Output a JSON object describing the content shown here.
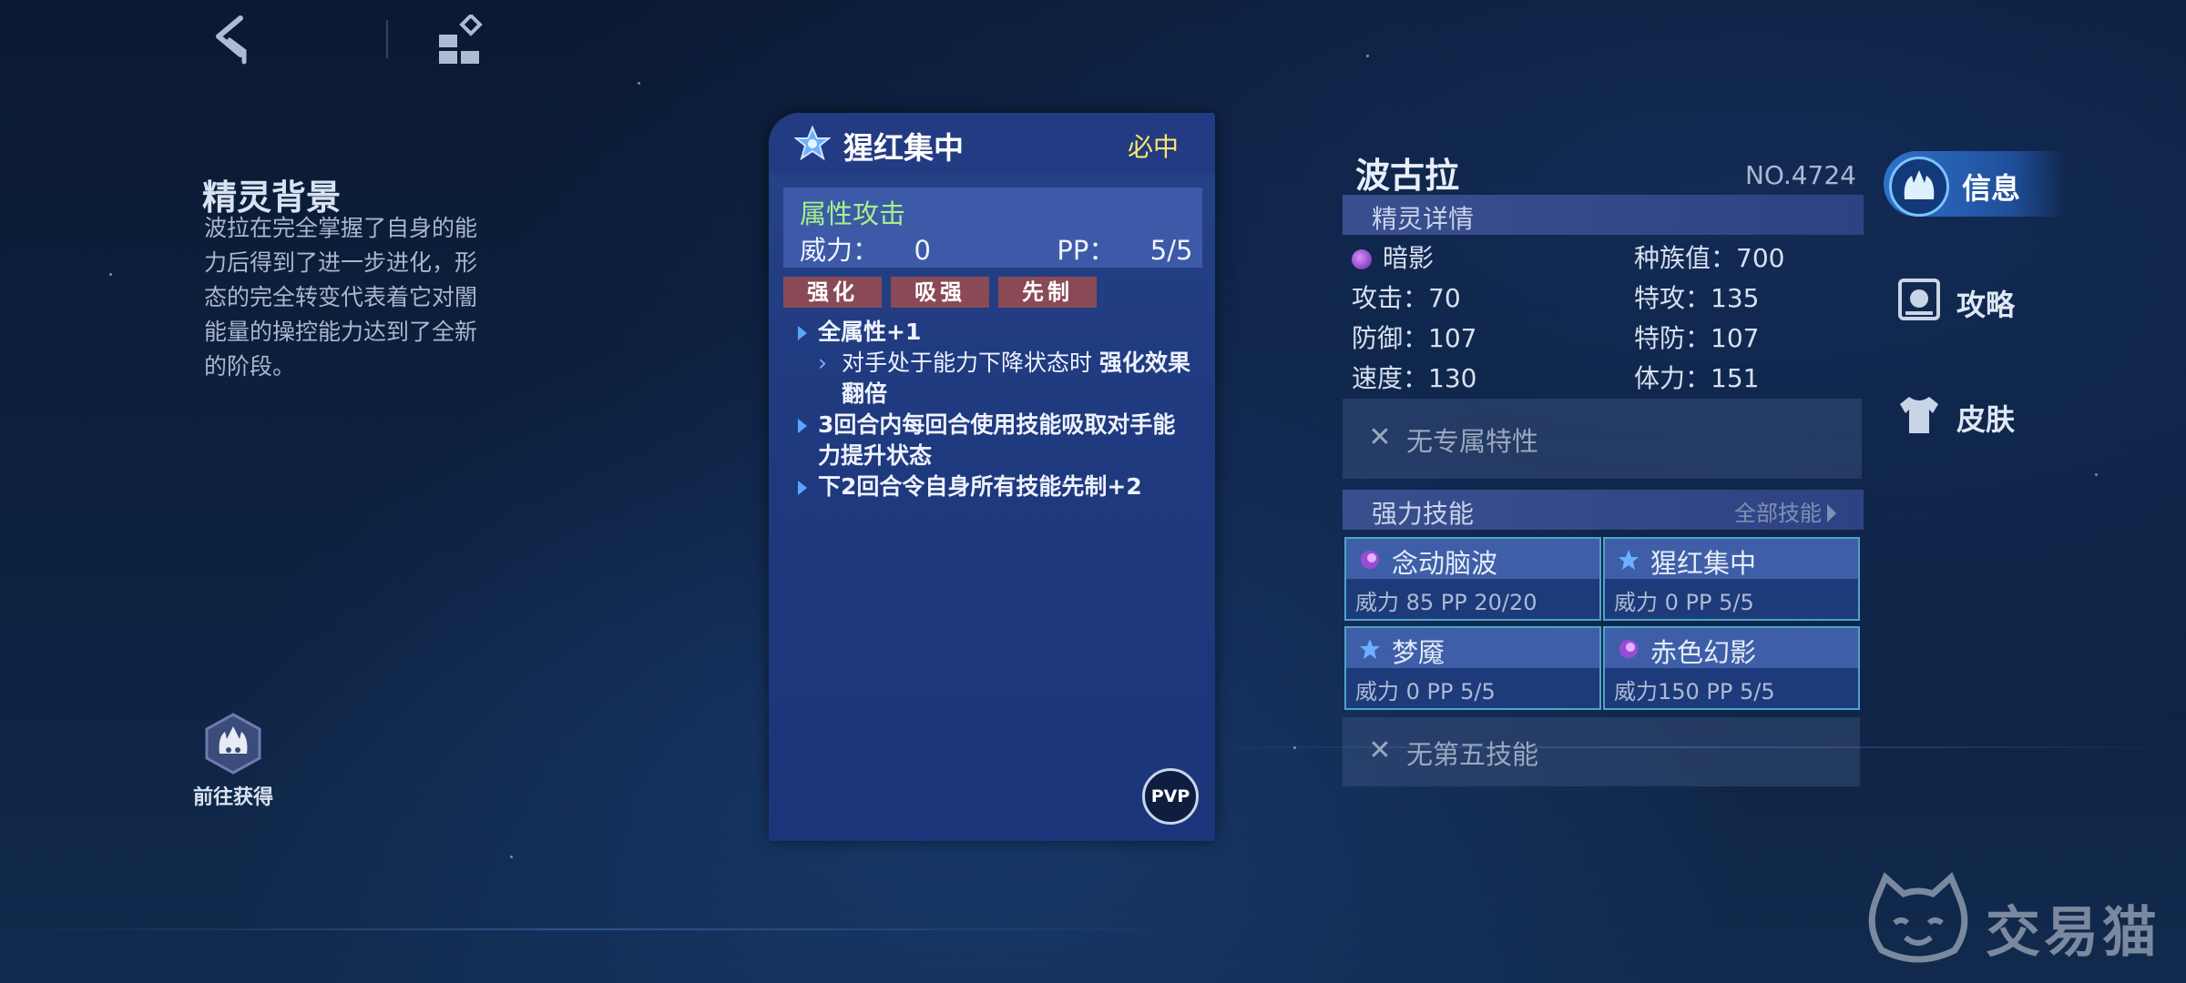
{
  "background": {
    "title": "精灵背景",
    "text": "波拉在完全掌握了自身的能力后得到了进一步进化，形态的完全转变代表着它对闇能量的操控能力达到了全新的阶段。"
  },
  "goto": {
    "label": "前往获得",
    "icon": "flame-hex-icon"
  },
  "skill_card": {
    "name": "猩红集中",
    "hit": "必中",
    "category": "属性攻击",
    "power_label": "威力：",
    "power": "0",
    "pp_label": "PP：",
    "pp": "5/5",
    "tags": [
      "强化",
      "吸强",
      "先制"
    ],
    "effects": {
      "e1": "全属性+1",
      "e1_sub_a": "对手处于能力下降状态时",
      "e1_sub_b": "强化效果翻倍",
      "e2": "3回合内每回合使用技能吸取对手能力提升状态",
      "e3": "下2回合令自身所有技能先制+2"
    },
    "pvp": "PVP"
  },
  "pet": {
    "name": "波古拉",
    "number": "NO.4724",
    "details_title": "精灵详情",
    "element": "暗影",
    "race_value": "种族值：700",
    "attack": "攻击：70",
    "sp_attack": "特攻：135",
    "defense": "防御：107",
    "sp_defense": "特防：107",
    "speed": "速度：130",
    "hp": "体力：151",
    "trait": "无专属特性",
    "skills_title": "强力技能",
    "all_skills": "全部技能",
    "skills": [
      {
        "name": "念动脑波",
        "info": "威力 85    PP 20/20",
        "icon": "dark-orb-icon"
      },
      {
        "name": "猩红集中",
        "info": "威力  0     PP    5/5",
        "icon": "star-icon"
      },
      {
        "name": "梦魇",
        "info": "威力  0     PP    5/5",
        "icon": "star-icon"
      },
      {
        "name": "赤色幻影",
        "info": "威力150   PP    5/5",
        "icon": "dark-orb-icon"
      }
    ],
    "fifth_skill": "无第五技能"
  },
  "tabs": {
    "info": "信息",
    "guide": "攻略",
    "skin": "皮肤"
  },
  "watermark": "交易猫",
  "colors": {
    "accent_yellow": "#ffe76a",
    "attr_green": "#a6f08a",
    "tag_red": "#8a4a55",
    "panel_blue": "#1f3a7e"
  }
}
